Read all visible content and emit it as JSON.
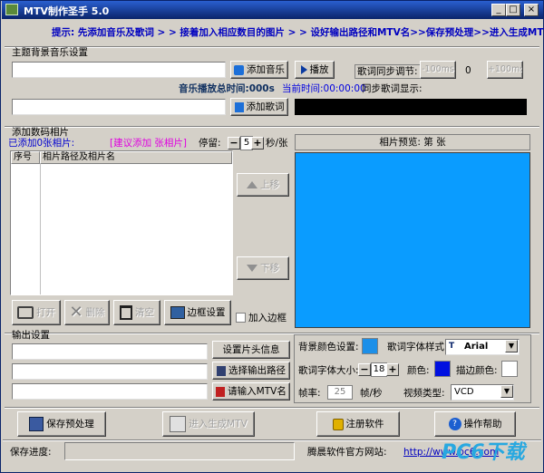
{
  "window": {
    "title": "MTV制作圣手 5.0",
    "btn_min": "_",
    "btn_max": "□",
    "btn_close": "×"
  },
  "hint": "提示: 先添加音乐及歌词 > > 接着加入相应数目的图片 > > 设好输出路径和MTV名>>保存预处理>>进入生成MTV",
  "music": {
    "section_title": "主题背景音乐设置",
    "music_path": "",
    "add_music": "添加音乐",
    "play": "播放",
    "lyric_sync_label": "歌词同步调节:",
    "minus": "-100ms",
    "offset": "0",
    "plus": "+100ms",
    "total_time_label": "音乐播放总时间:000s",
    "current_time_label": "当前时间:00:00:00",
    "sync_display_label": "同步歌词显示:",
    "lyric_path": "",
    "add_lyric": "添加歌词"
  },
  "photos": {
    "section_title": "添加数码相片",
    "added_label": "已添加0张相片:",
    "suggest_label": "[建议添加    张相片]",
    "stay_label": "停留:",
    "stay_value": "5",
    "per_label": "秒/张",
    "columns": [
      "序号",
      "相片路径及相片名"
    ],
    "up": "上移",
    "down": "下移",
    "open": "打开",
    "delete": "删除",
    "clear": "清空",
    "frame_settings": "边框设置",
    "add_frame": "加入边框",
    "preview_label": "相片预览: 第  张"
  },
  "output": {
    "section_title": "输出设置",
    "field1": "",
    "field2": "",
    "field3": "",
    "header_info": "设置片头信息",
    "choose_path": "选择输出路径",
    "mtv_name": "请输入MTV名",
    "bg_color_label": "背景颜色设置:",
    "font_style_label": "歌词字体样式:",
    "font_name": "Arial",
    "font_size_label": "歌词字体大小:",
    "font_size": "18",
    "color_label": "颜色:",
    "border_color_label": "描边颜色:",
    "fps_label": "帧率:",
    "fps_value": "25",
    "fps_unit": "帧/秒",
    "video_type_label": "视频类型:",
    "video_type": "VCD",
    "bg_color": "#1c8fe8",
    "lyric_color": "#0010e0",
    "border_color": "#ffffff"
  },
  "actions": {
    "save": "保存预处理",
    "generate": "进入生成MTV",
    "register": "注册软件",
    "help": "操作帮助"
  },
  "status": {
    "progress_label": "保存进度:",
    "site_label": "腾晨软件官方网站:",
    "url": "http://www.pc6.com",
    "watermark": "PC6下载"
  }
}
